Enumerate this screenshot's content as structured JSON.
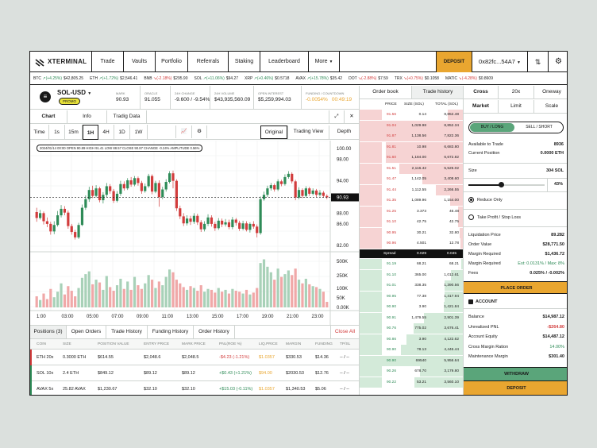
{
  "header": {
    "logo": "XTERMINAL",
    "nav": [
      "Trade",
      "Vaults",
      "Portfolio",
      "Referrals",
      "Staking",
      "Leaderboard",
      "More"
    ],
    "deposit": "DEPOSIT",
    "wallet": "0x82fc...54A7"
  },
  "ticker": [
    {
      "sym": "BTC",
      "chg": "(+4.25%)",
      "price": "$42,805.25",
      "dir": "up"
    },
    {
      "sym": "ETH",
      "chg": "(+1.72%)",
      "price": "$2,546.41",
      "dir": "up"
    },
    {
      "sym": "BNB",
      "chg": "(-2.18%)",
      "price": "$295.90",
      "dir": "down"
    },
    {
      "sym": "SOL",
      "chg": "(+11.06%)",
      "price": "$94.27",
      "dir": "up"
    },
    {
      "sym": "XRP",
      "chg": "(+0.46%)",
      "price": "$0.5718",
      "dir": "up"
    },
    {
      "sym": "AVAX",
      "chg": "(+15.78%)",
      "price": "$35.42",
      "dir": "up"
    },
    {
      "sym": "DOT",
      "chg": "(-2.88%)",
      "price": "$7.59",
      "dir": "down"
    },
    {
      "sym": "TRX",
      "chg": "(+0.75%)",
      "price": "$0.1058",
      "dir": "down"
    },
    {
      "sym": "MATIC",
      "chg": "(-4.28%)",
      "price": "$0.8609",
      "dir": "down"
    }
  ],
  "market": {
    "pair": "SOL-USD",
    "promo": "PROMO",
    "stats": [
      {
        "label": "MARK",
        "value": "90.93",
        "cls": ""
      },
      {
        "label": "ORACLE",
        "value": "91.055",
        "cls": ""
      },
      {
        "label": "24H CHANGE",
        "value": "-9.600 / -9.54%",
        "cls": ""
      },
      {
        "label": "24H VOLUME",
        "value": "$43,935,560.09",
        "cls": ""
      },
      {
        "label": "OPEN INTEREST",
        "value": "$5,259,994.03",
        "cls": ""
      },
      {
        "label": "FUNDING / COUNTDOWN",
        "value": "-0.0054%",
        "value2": "00:49:19",
        "cls": "orange"
      }
    ]
  },
  "chart": {
    "tabs": [
      "Chart",
      "Info",
      "Tradig Data"
    ],
    "times": [
      "Time",
      "1s",
      "15m",
      "1H",
      "4H",
      "1D",
      "1W"
    ],
    "views": [
      "Original",
      "Trading View",
      "Depth"
    ],
    "ohlc": "2024/01/14 00:00  OPEN 90.89  HIGH 91.41  LOW 88.57  CLOSE 90.87  CHANGE -0.24%  AMPLITUDE 0.56%",
    "price_axis": [
      "100.00",
      "98.00",
      "94.00",
      "90.93",
      "88.00",
      "86.00",
      "82.00"
    ],
    "vol_axis": [
      "500K",
      "250K",
      "100K",
      "50K",
      "0.00K"
    ],
    "time_axis": [
      "1:00",
      "03:00",
      "05:00",
      "07:00",
      "09:00",
      "11:00",
      "13:00",
      "15:00",
      "17:00",
      "19:00",
      "21:00",
      "23:00"
    ]
  },
  "chart_data": {
    "type": "candlestick",
    "ylim": [
      82,
      100
    ],
    "last": 90.93,
    "candles": [
      [
        88.2,
        87.1,
        89.0,
        86.4
      ],
      [
        87.1,
        88.0,
        88.6,
        86.8
      ],
      [
        88.0,
        86.5,
        88.3,
        85.9
      ],
      [
        86.5,
        86.0,
        87.2,
        85.4
      ],
      [
        86.0,
        84.6,
        86.4,
        84.0
      ],
      [
        84.6,
        85.8,
        86.5,
        84.1
      ],
      [
        85.8,
        87.6,
        88.4,
        85.5
      ],
      [
        87.6,
        88.8,
        89.5,
        87.2
      ],
      [
        88.8,
        88.1,
        89.3,
        87.6
      ],
      [
        88.1,
        85.6,
        88.5,
        85.1
      ],
      [
        85.6,
        84.5,
        86.0,
        84.0
      ],
      [
        84.5,
        83.5,
        84.9,
        83.1
      ],
      [
        83.5,
        85.8,
        86.2,
        83.2
      ],
      [
        85.8,
        89.0,
        89.6,
        85.6
      ],
      [
        89.0,
        90.6,
        91.3,
        88.6
      ],
      [
        90.6,
        92.3,
        92.9,
        90.1
      ],
      [
        92.3,
        91.2,
        93.1,
        90.8
      ],
      [
        91.2,
        92.6,
        93.2,
        90.9
      ],
      [
        92.6,
        90.4,
        92.9,
        90.0
      ],
      [
        90.4,
        91.4,
        91.9,
        89.8
      ],
      [
        91.4,
        93.0,
        93.6,
        91.0
      ],
      [
        93.0,
        92.1,
        93.4,
        91.6
      ],
      [
        92.1,
        90.3,
        92.5,
        89.9
      ],
      [
        90.3,
        91.6,
        92.1,
        90.0
      ],
      [
        91.6,
        93.4,
        94.0,
        91.2
      ],
      [
        93.4,
        92.6,
        93.9,
        92.2
      ],
      [
        92.6,
        94.1,
        94.5,
        92.3
      ],
      [
        94.1,
        93.3,
        94.7,
        92.9
      ],
      [
        93.3,
        94.5,
        94.9,
        93.0
      ],
      [
        94.5,
        93.6,
        94.8,
        93.1
      ],
      [
        93.6,
        92.1,
        94.0,
        91.6
      ],
      [
        92.1,
        93.0,
        93.5,
        91.8
      ],
      [
        93.0,
        94.9,
        95.3,
        92.7
      ],
      [
        94.9,
        92.0,
        95.2,
        91.5
      ],
      [
        92.0,
        93.6,
        94.0,
        91.7
      ],
      [
        93.6,
        91.0,
        94.1,
        89.2
      ],
      [
        91.0,
        92.4,
        92.9,
        90.6
      ],
      [
        92.4,
        93.8,
        94.3,
        92.0
      ],
      [
        93.8,
        95.4,
        95.8,
        93.5
      ],
      [
        95.4,
        94.0,
        95.9,
        92.6
      ],
      [
        94.0,
        88.9,
        94.3,
        88.4
      ],
      [
        88.9,
        87.4,
        89.4,
        86.9
      ],
      [
        87.4,
        86.1,
        88.0,
        85.6
      ],
      [
        86.1,
        87.0,
        87.6,
        85.7
      ],
      [
        87.0,
        86.4,
        87.5,
        85.8
      ],
      [
        86.4,
        87.5,
        88.0,
        86.0
      ],
      [
        87.5,
        86.3,
        87.9,
        85.8
      ],
      [
        86.3,
        85.0,
        86.7,
        84.5
      ],
      [
        85.0,
        86.0,
        86.5,
        84.6
      ],
      [
        86.0,
        87.2,
        87.8,
        85.6
      ],
      [
        87.2,
        86.0,
        87.6,
        85.5
      ],
      [
        86.0,
        85.2,
        86.4,
        84.7
      ],
      [
        85.2,
        86.6,
        87.1,
        84.9
      ],
      [
        86.6,
        85.9,
        87.0,
        85.4
      ],
      [
        85.9,
        86.3,
        86.9,
        85.5
      ],
      [
        86.3,
        85.4,
        86.8,
        85.0
      ],
      [
        85.4,
        86.8,
        87.3,
        85.0
      ],
      [
        86.8,
        86.2,
        87.1,
        85.7
      ],
      [
        86.2,
        85.1,
        86.6,
        84.7
      ],
      [
        85.1,
        86.1,
        86.6,
        84.8
      ],
      [
        86.1,
        84.9,
        86.5,
        84.6
      ],
      [
        84.9,
        86.0,
        86.3,
        84.4
      ],
      [
        86.0,
        85.5,
        86.5,
        85.1
      ],
      [
        85.5,
        84.3,
        85.9,
        83.5
      ],
      [
        84.3,
        90.6,
        91.1,
        84.0
      ],
      [
        90.6,
        91.4,
        92.0,
        90.3
      ],
      [
        91.4,
        92.6,
        93.1,
        91.0
      ],
      [
        92.6,
        93.2,
        93.6,
        92.2
      ],
      [
        93.2,
        92.4,
        93.5,
        92.0
      ],
      [
        92.4,
        93.9,
        94.3,
        92.1
      ],
      [
        93.9,
        93.4,
        94.2,
        93.0
      ],
      [
        93.4,
        94.7,
        95.2,
        93.1
      ],
      [
        94.7,
        95.3,
        95.8,
        94.4
      ],
      [
        95.3,
        93.9,
        95.6,
        93.5
      ],
      [
        93.9,
        90.9,
        94.2,
        90.4
      ],
      [
        90.9,
        92.3,
        92.8,
        90.6
      ],
      [
        92.3,
        91.2,
        92.6,
        90.8
      ],
      [
        91.2,
        92.6,
        93.0,
        90.9
      ],
      [
        92.6,
        91.6,
        92.9,
        91.2
      ],
      [
        91.6,
        92.2,
        92.6,
        91.3
      ],
      [
        92.2,
        91.4,
        92.5,
        91.0
      ],
      [
        91.4,
        91.8,
        92.3,
        91.1
      ],
      [
        91.8,
        91.2,
        92.1,
        90.9
      ],
      [
        91.2,
        90.93,
        91.5,
        90.6
      ]
    ],
    "volumes": [
      120,
      80,
      150,
      90,
      200,
      110,
      170,
      260,
      140,
      230,
      180,
      120,
      210,
      320,
      360,
      390,
      250,
      300,
      270,
      190,
      340,
      220,
      180,
      240,
      310,
      200,
      280,
      190,
      330,
      240,
      200,
      260,
      350,
      300,
      210,
      280,
      240,
      330,
      410,
      380,
      300,
      260,
      220,
      190,
      230,
      210,
      180,
      240,
      170,
      200,
      190,
      160,
      210,
      170,
      190,
      150,
      200,
      180,
      170,
      150,
      190,
      140,
      160,
      210,
      480,
      520,
      440,
      380,
      300,
      420,
      330,
      360,
      400,
      350,
      420,
      300,
      260,
      310,
      250,
      230,
      220,
      200,
      170,
      60
    ]
  },
  "positions": {
    "tabs": [
      "Positions (3)",
      "Open Orders",
      "Trade History",
      "Funding History",
      "Order History"
    ],
    "close_all": "Close All",
    "cols": [
      "COIN",
      "SIZE",
      "POSITION VALUE",
      "ENTRY PRICE",
      "MARK PRICE",
      "PNL(ROE %)",
      "LIQ.PRICE",
      "MARGIN",
      "FUNDING",
      "TP/SL"
    ],
    "rows": [
      [
        "ETH 20x",
        "0.3000 ETH",
        "$614.55",
        "$2,048.6",
        "$2,048.5",
        "-$4.23 (-1.21%)",
        "$1.0357",
        "$330.53",
        "$14.36",
        "-- / --"
      ],
      [
        "SOL 10x",
        "2.4 ETH",
        "$849.12",
        "$89.12",
        "$89.12",
        "+$0.43 (+1.21%)",
        "$94.00",
        "$2030.53",
        "$12.76",
        "-- / --"
      ],
      [
        "AVAX 5x",
        "25.82 AVAX",
        "$1,230.67",
        "$32.10",
        "$32.10",
        "+$15.03 (-0.11%)",
        "$1.0357",
        "$1,340.53",
        "$5.06",
        "-- / --"
      ]
    ],
    "pnl_cls": [
      "red",
      "green",
      "green"
    ],
    "liq_cls": [
      "orange",
      "orange",
      "orange"
    ]
  },
  "orderbook": {
    "tabs": [
      "Order book",
      "Trade history"
    ],
    "cols": [
      "PRICE",
      "SIZE (SOL)",
      "TOTAL (SOL)"
    ],
    "asks": [
      [
        "91.56",
        "0.14",
        "8,852.48",
        0.15
      ],
      [
        "91.04",
        "1,029.98",
        "8,852.34",
        0.95
      ],
      [
        "91.87",
        "1,138.56",
        "7,822.36",
        0.8
      ],
      [
        "91.81",
        "10.98",
        "6,683.80",
        0.75
      ],
      [
        "91.60",
        "1,184.00",
        "6,672.82",
        0.75
      ],
      [
        "91.51",
        "2,116.42",
        "5,525.02",
        0.62
      ],
      [
        "91.47",
        "1,142.05",
        "3,408.60",
        0.4
      ],
      [
        "91.44",
        "1,112.55",
        "2,266.55",
        0.27
      ],
      [
        "91.35",
        "1,089.96",
        "1,154.00",
        0.13
      ],
      [
        "91.25",
        "3.373",
        "46.48",
        0.05
      ],
      [
        "91.10",
        "42.75",
        "42.75",
        0.05
      ],
      [
        "90.95",
        "30.21",
        "32.80",
        0.04
      ],
      [
        "90.96",
        "4.501",
        "12.78",
        0.03
      ]
    ],
    "spread": [
      "Spread",
      "0.029",
      "0.045"
    ],
    "bids": [
      [
        "91.19",
        "68.21",
        "68.21",
        0.02
      ],
      [
        "91.10",
        "365.00",
        "1,012.61",
        0.12
      ],
      [
        "91.01",
        "338.35",
        "1,390.56",
        0.18
      ],
      [
        "90.95",
        "77.38",
        "1,417.94",
        0.18
      ],
      [
        "90.90",
        "3.90",
        "1,421.84",
        0.19
      ],
      [
        "90.91",
        "1,479.55",
        "2,901.39",
        0.38
      ],
      [
        "90.76",
        "775.02",
        "3,676.41",
        0.48
      ],
      [
        "90.86",
        "3.90",
        "4,122.62",
        0.55
      ],
      [
        "90.90",
        "78.13",
        "4,446.44",
        0.6
      ],
      [
        "90.90",
        "69540",
        "5,956.64",
        0.8
      ],
      [
        "90.26",
        "678.70",
        "3,179.80",
        0.42
      ],
      [
        "90.22",
        "53.21",
        "3,560.10",
        0.47
      ]
    ]
  },
  "panel": {
    "margin_tabs": [
      "Cross",
      "20x",
      "Oneway"
    ],
    "order_tabs": [
      "Market",
      "Limit",
      "Scale"
    ],
    "buy": "BUY / LONG",
    "sell": "SELL / SHORT",
    "avail_label": "Available to Trade",
    "avail_val": "8936",
    "pos_label": "Current Position",
    "pos_val": "0.0000 ETH",
    "size_label": "Size",
    "size_val": "304 SOL",
    "pct": "43%",
    "pct_value": 43,
    "reduce": "Reduce Only",
    "tpsl": "Take Profit / Stop Loss",
    "info": [
      [
        "Liquidation Price",
        "89.282",
        ""
      ],
      [
        "Order Value",
        "$28,771.50",
        ""
      ],
      [
        "Margin Required",
        "$1,436.72",
        ""
      ],
      [
        "Margin Required",
        "Est: 0.0131% / Max: 8%",
        "green"
      ],
      [
        "Fees",
        "0.025% / -0.002%",
        ""
      ]
    ],
    "place": "PLACE ORDER",
    "account": "ACCOUNT",
    "acct": [
      [
        "Balance",
        "$14,987.12",
        ""
      ],
      [
        "Unrealized PNL",
        "-$264.80",
        "red"
      ],
      [
        "Account Equity",
        "$14,487.12",
        ""
      ],
      [
        "Cross Margin Ration",
        "14.00%",
        "green"
      ],
      [
        "Maintenance Margin",
        "$301.40",
        ""
      ]
    ],
    "withdraw": "WITHDRAW",
    "deposit": "DEPOSIT"
  },
  "colors": {
    "green": "#2e8b57",
    "red": "#d23c3c",
    "orange": "#e9a630",
    "greenbtn": "#5aa57a"
  }
}
